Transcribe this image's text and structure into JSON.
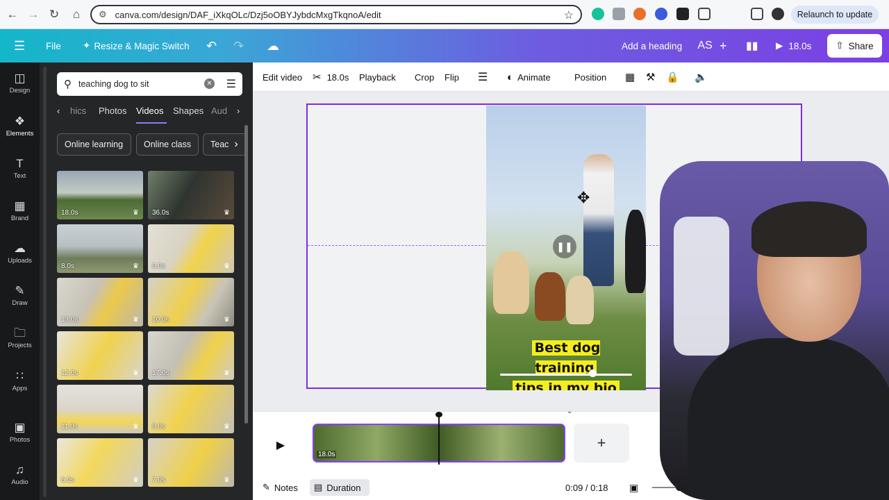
{
  "browser": {
    "url": "canva.com/design/DAF_iXkqOLc/Dzj5oOBYJybdcMxgTkqnoA/edit",
    "relaunch_label": "Relaunch to update"
  },
  "header": {
    "menu_icon": "hamburger-icon",
    "file_label": "File",
    "resize_label": "Resize & Magic Switch",
    "add_heading_label": "Add a heading",
    "avatar_initials": "AS",
    "play_duration": "18.0s",
    "share_label": "Share"
  },
  "rail": {
    "items": [
      {
        "label": "Design",
        "icon": "design-icon"
      },
      {
        "label": "Elements",
        "icon": "elements-icon"
      },
      {
        "label": "Text",
        "icon": "text-icon"
      },
      {
        "label": "Brand",
        "icon": "brand-icon"
      },
      {
        "label": "Uploads",
        "icon": "uploads-icon"
      },
      {
        "label": "Draw",
        "icon": "draw-icon"
      },
      {
        "label": "Projects",
        "icon": "projects-icon"
      },
      {
        "label": "Apps",
        "icon": "apps-icon"
      },
      {
        "label": "Photos",
        "icon": "photos-icon"
      },
      {
        "label": "Audio",
        "icon": "audio-icon"
      }
    ]
  },
  "panel": {
    "search_value": "teaching dog to sit",
    "tabs": [
      "hics",
      "Photos",
      "Videos",
      "Shapes",
      "Aud"
    ],
    "active_tab": "Videos",
    "chips": [
      "Online learning",
      "Online class",
      "Teac"
    ],
    "videos": [
      "18.0s",
      "36.0s",
      "8.0s",
      "8.0s",
      "13.0s",
      "10.0s",
      "12.0s",
      "17.0s",
      "11.0s",
      "8.0s",
      "6.0s",
      "7.0s"
    ]
  },
  "toolbar": {
    "edit_video": "Edit video",
    "trim_duration": "18.0s",
    "playback": "Playback",
    "crop": "Crop",
    "flip": "Flip",
    "animate": "Animate",
    "position": "Position"
  },
  "canvas": {
    "caption_line1": "Best dog training",
    "caption_line2": "tips in my bio",
    "video_progress": 0.5
  },
  "timeline": {
    "clip_duration": "18.0s",
    "notes_label": "Notes",
    "duration_label": "Duration",
    "time_display": "0:09 / 0:18"
  },
  "colors": {
    "accent": "#7d2ae8",
    "header_start": "#13b6c9",
    "header_end": "#7b3fe4",
    "caption_bg": "#f5ee1e"
  }
}
